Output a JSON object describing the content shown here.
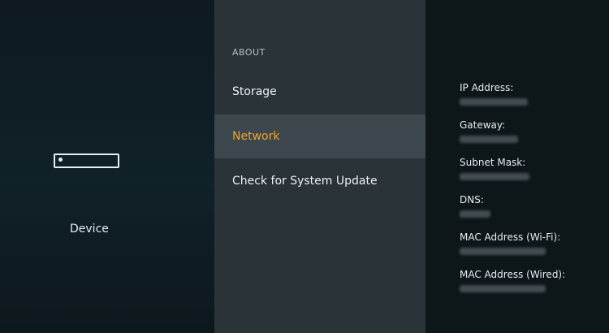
{
  "device_panel": {
    "label": "Device",
    "icon": "tv-remote-icon"
  },
  "about_menu": {
    "header": "ABOUT",
    "items": [
      {
        "label": "Storage",
        "selected": false
      },
      {
        "label": "Network",
        "selected": true
      },
      {
        "label": "Check for System Update",
        "selected": false
      }
    ],
    "accent_color": "#f4a12a"
  },
  "network_info": {
    "fields": [
      {
        "label": "IP Address:",
        "value": ""
      },
      {
        "label": "Gateway:",
        "value": ""
      },
      {
        "label": "Subnet Mask:",
        "value": ""
      },
      {
        "label": "DNS:",
        "value": ""
      },
      {
        "label": "MAC Address (Wi-Fi):",
        "value": ""
      },
      {
        "label": "MAC Address (Wired):",
        "value": ""
      }
    ],
    "values_obscured": true
  }
}
